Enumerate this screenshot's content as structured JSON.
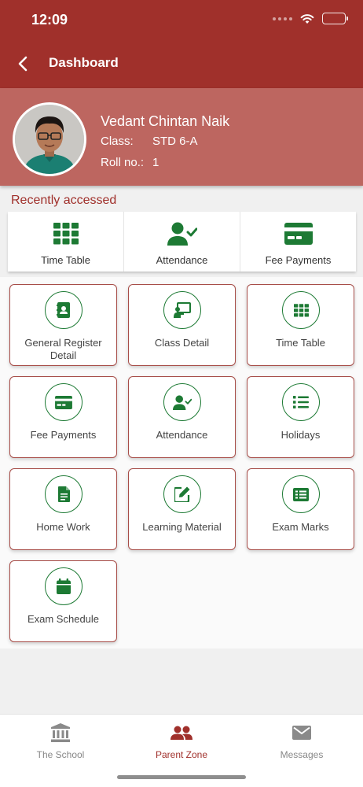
{
  "status_bar": {
    "time": "12:09"
  },
  "nav": {
    "title": "Dashboard"
  },
  "profile": {
    "name": "Vedant Chintan Naik",
    "class_label": "Class:",
    "class_value": "STD 6-A",
    "roll_label": "Roll no.:",
    "roll_value": "1"
  },
  "recent": {
    "title": "Recently accessed",
    "items": [
      {
        "label": "Time Table",
        "icon": "grid-icon"
      },
      {
        "label": "Attendance",
        "icon": "user-check-icon"
      },
      {
        "label": "Fee Payments",
        "icon": "credit-card-icon"
      }
    ]
  },
  "tiles": [
    {
      "label": "General Register Detail",
      "icon": "contacts-book-icon"
    },
    {
      "label": "Class Detail",
      "icon": "presentation-icon"
    },
    {
      "label": "Time Table",
      "icon": "grid-icon"
    },
    {
      "label": "Fee Payments",
      "icon": "credit-card-icon"
    },
    {
      "label": "Attendance",
      "icon": "user-check-icon"
    },
    {
      "label": "Holidays",
      "icon": "list-icon"
    },
    {
      "label": "Home Work",
      "icon": "document-icon"
    },
    {
      "label": "Learning Material",
      "icon": "edit-icon"
    },
    {
      "label": "Exam Marks",
      "icon": "marks-sheet-icon"
    },
    {
      "label": "Exam Schedule",
      "icon": "calendar-icon"
    }
  ],
  "tabs": [
    {
      "label": "The School",
      "icon": "school-icon",
      "active": false
    },
    {
      "label": "Parent Zone",
      "icon": "people-icon",
      "active": true
    },
    {
      "label": "Messages",
      "icon": "mail-icon",
      "active": false
    }
  ],
  "colors": {
    "primary": "#a0302b",
    "accent_green": "#1d7a34",
    "profile_bg": "#bd6660"
  }
}
